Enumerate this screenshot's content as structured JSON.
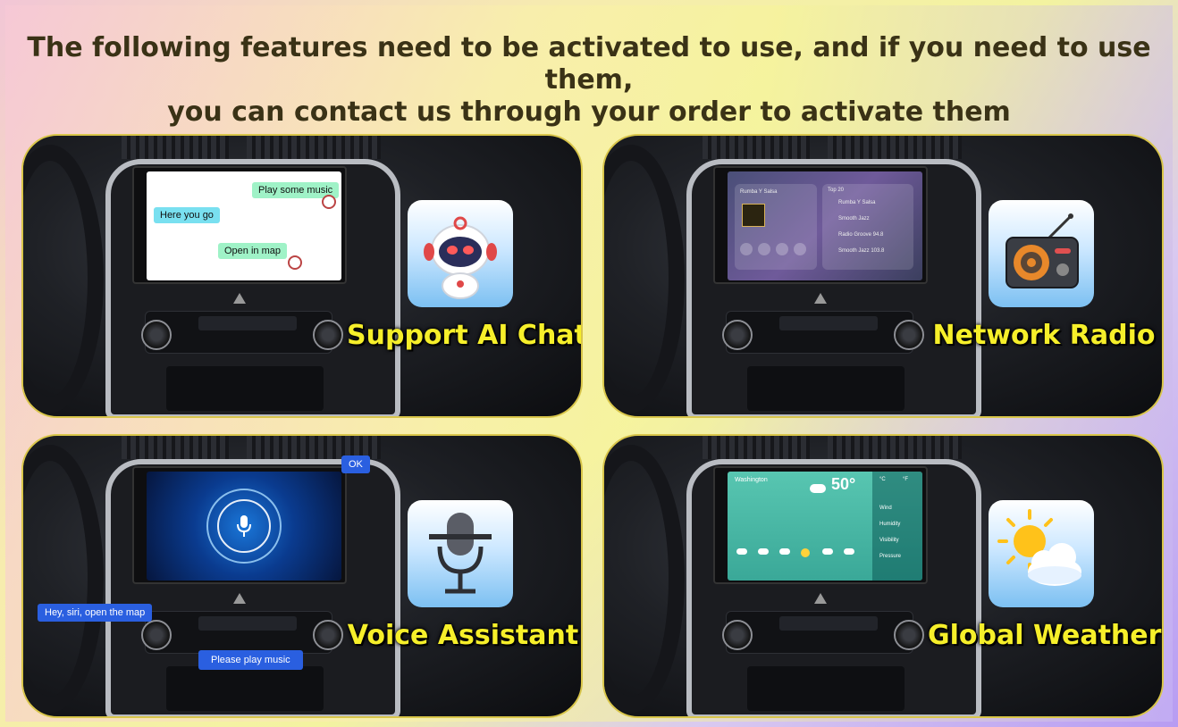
{
  "header": {
    "line1": "The following features need to be activated to use, and if you need to use them,",
    "line2": "you can contact us through your order to activate them"
  },
  "features": [
    {
      "label": "Support AI Chat",
      "icon": "robot-icon",
      "chat": {
        "msg1": "Play some music",
        "msg2": "Here you go",
        "msg3": "Open in map"
      }
    },
    {
      "label": "Network Radio",
      "icon": "radio-icon",
      "screen": {
        "station": "Rumba Y Salsa",
        "list_title": "Top 20",
        "items": [
          "Rumba Y Salsa",
          "Smooth Jazz",
          "Radio Groove 94.8",
          "Smooth Jazz 103.8"
        ]
      }
    },
    {
      "label": "Voice Assistant",
      "icon": "microphone-icon",
      "bubbles": {
        "ok": "OK",
        "siri": "Hey, siri, open the map",
        "music": "Please play music"
      }
    },
    {
      "label": "Global Weather",
      "icon": "weather-icon",
      "screen": {
        "city": "Washington",
        "temp": "50°",
        "unit_c": "°C",
        "unit_f": "°F",
        "details": [
          "Wind",
          "Humidity",
          "Visibility",
          "Pressure"
        ]
      }
    }
  ],
  "colors": {
    "label_yellow": "#f6ef2a",
    "chip_blue": "#2a5fe0",
    "chat_green": "#9ff2c7",
    "chat_cyan": "#79e0f0"
  }
}
